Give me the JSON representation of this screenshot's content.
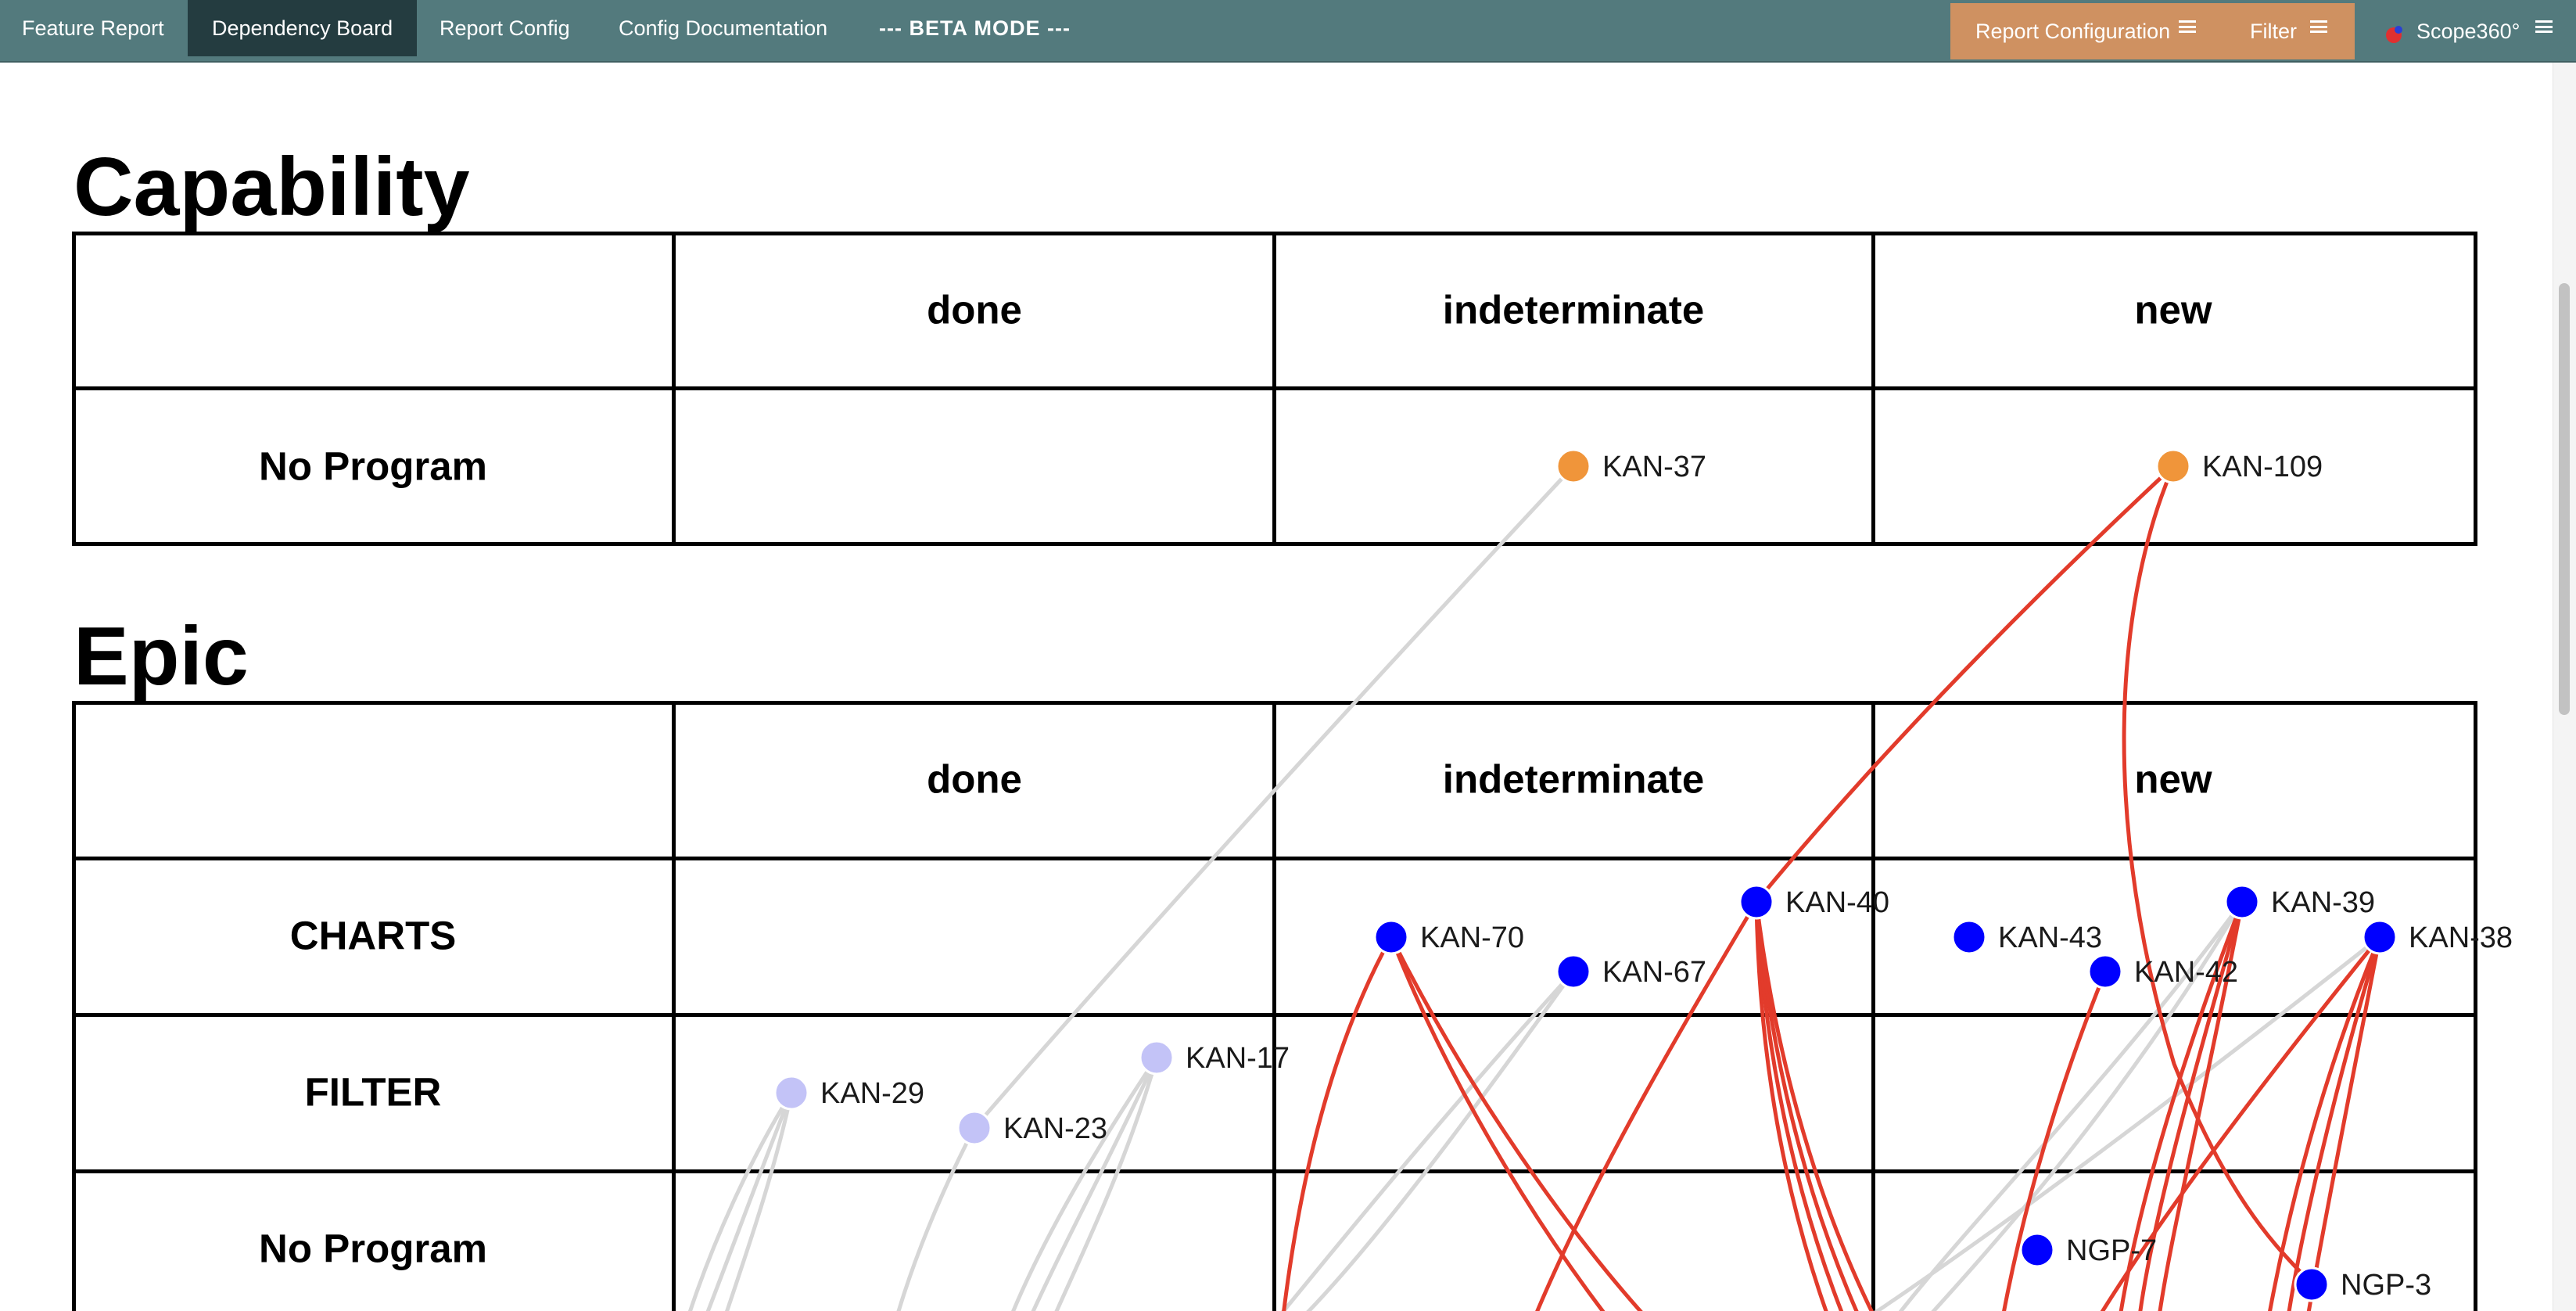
{
  "nav": {
    "links": [
      {
        "label": "Feature Report"
      },
      {
        "label": "Dependency Board"
      },
      {
        "label": "Report Config"
      },
      {
        "label": "Config Documentation"
      },
      {
        "label": "--- BETA MODE ---"
      }
    ],
    "report_configuration": "Report Configuration",
    "filter": "Filter",
    "brand": "Scope360°"
  },
  "colors": {
    "navbar": "#537a7d",
    "active_tab": "#243c40",
    "orange_panel": "#cf9161",
    "capability_node": "#f0953a",
    "epic_node": "#0000ff",
    "done_node": "#c3c3f7",
    "blocked_edge": "#e23b2b",
    "normal_edge": "#d6d6d6"
  },
  "board": {
    "columns": [
      "done",
      "indeterminate",
      "new"
    ],
    "capability": {
      "title": "Capability",
      "rows": [
        "No Program"
      ]
    },
    "epic": {
      "title": "Epic",
      "rows": [
        "CHARTS",
        "FILTER",
        "No Program"
      ]
    }
  },
  "nodes": [
    {
      "id": "KAN-37",
      "section": "Capability",
      "row": "No Program",
      "status": "indeterminate",
      "kind": "capability"
    },
    {
      "id": "KAN-109",
      "section": "Capability",
      "row": "No Program",
      "status": "new",
      "kind": "capability"
    },
    {
      "id": "KAN-70",
      "section": "Epic",
      "row": "CHARTS",
      "status": "indeterminate",
      "kind": "epic"
    },
    {
      "id": "KAN-67",
      "section": "Epic",
      "row": "CHARTS",
      "status": "indeterminate",
      "kind": "epic"
    },
    {
      "id": "KAN-40",
      "section": "Epic",
      "row": "CHARTS",
      "status": "indeterminate",
      "kind": "epic"
    },
    {
      "id": "KAN-43",
      "section": "Epic",
      "row": "CHARTS",
      "status": "new",
      "kind": "epic"
    },
    {
      "id": "KAN-42",
      "section": "Epic",
      "row": "CHARTS",
      "status": "new",
      "kind": "epic"
    },
    {
      "id": "KAN-39",
      "section": "Epic",
      "row": "CHARTS",
      "status": "new",
      "kind": "epic"
    },
    {
      "id": "KAN-38",
      "section": "Epic",
      "row": "CHARTS",
      "status": "new",
      "kind": "epic"
    },
    {
      "id": "KAN-29",
      "section": "Epic",
      "row": "FILTER",
      "status": "done",
      "kind": "done"
    },
    {
      "id": "KAN-23",
      "section": "Epic",
      "row": "FILTER",
      "status": "done",
      "kind": "done"
    },
    {
      "id": "KAN-17",
      "section": "Epic",
      "row": "FILTER",
      "status": "done",
      "kind": "done"
    },
    {
      "id": "NGP-7",
      "section": "Epic",
      "row": "No Program",
      "status": "new",
      "kind": "epic"
    },
    {
      "id": "NGP-3",
      "section": "Epic",
      "row": "No Program",
      "status": "new",
      "kind": "epic"
    }
  ]
}
